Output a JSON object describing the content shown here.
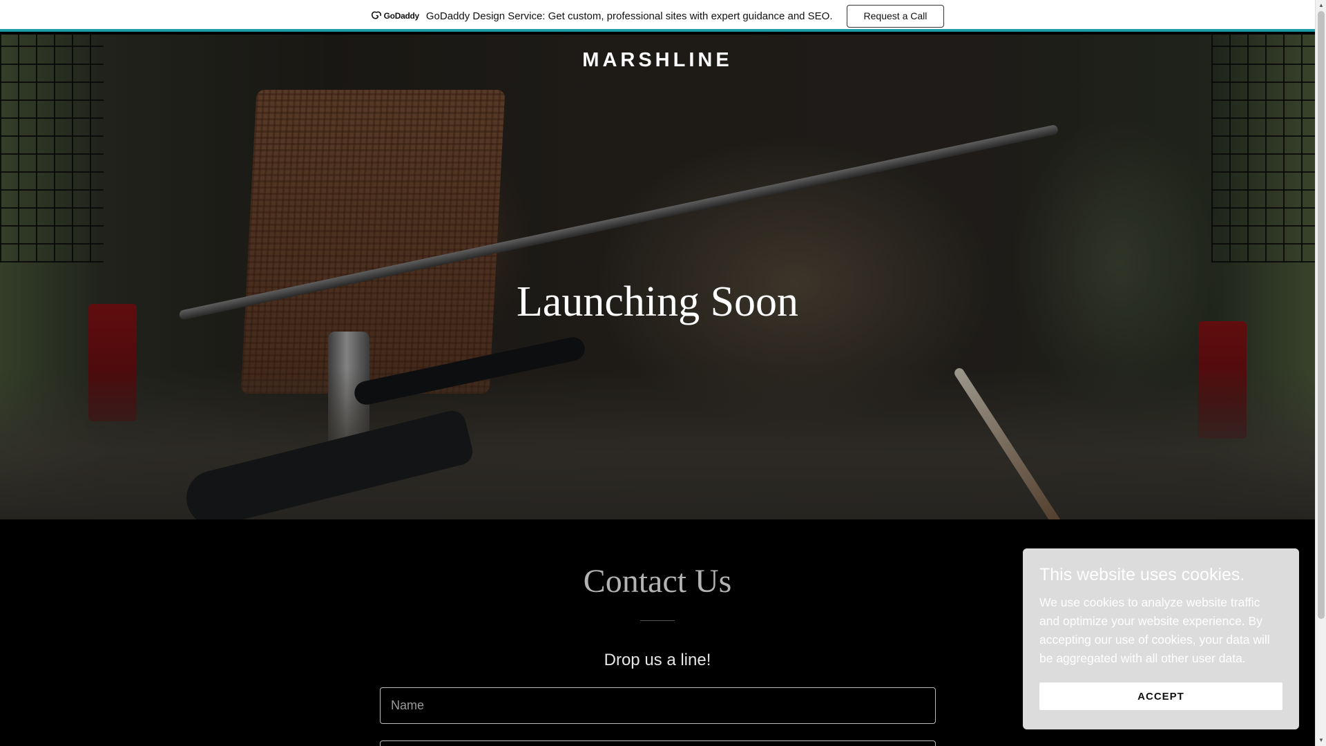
{
  "promo": {
    "logo_text": "GoDaddy",
    "message": "GoDaddy Design Service: Get custom, professional sites with expert guidance and SEO.",
    "cta_label": "Request a Call",
    "accent_color": "#1e9ca8"
  },
  "hero": {
    "brand": "MARSHLINE",
    "title": "Launching Soon"
  },
  "contact": {
    "title": "Contact Us",
    "subtitle": "Drop us a line!",
    "name_placeholder": "Name",
    "email_placeholder": ""
  },
  "cookie": {
    "title": "This website uses cookies.",
    "body": "We use cookies to analyze website traffic and optimize your website experience. By accepting our use of cookies, your data will be aggregated with all other user data.",
    "accept_label": "ACCEPT"
  },
  "icons": {
    "logo": "godaddy-logo-icon",
    "scroll_up": "scroll-up-arrow-icon",
    "scroll_down": "scroll-down-arrow-icon"
  }
}
